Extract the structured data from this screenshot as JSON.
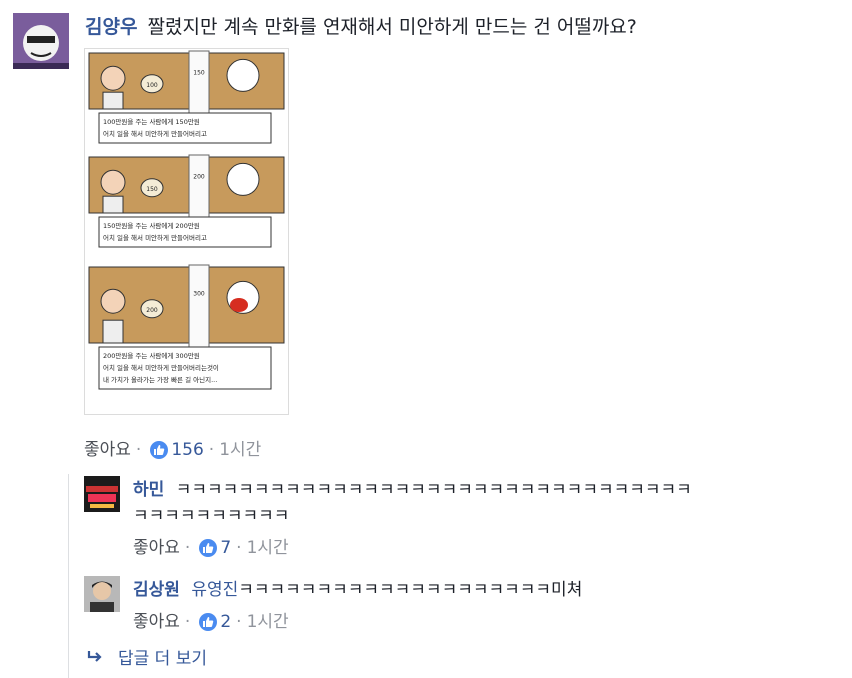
{
  "comment": {
    "author": "김양우",
    "text": "짤렸지만 계속 만화를 연재해서 미안하게 만드는 건 어떨까요?",
    "like_label": "좋아요",
    "like_count": "156",
    "time": "1시간",
    "comic": {
      "panels": [
        {
          "bag": "100",
          "board": "150",
          "caption_lines": [
            "100만원을 주는 사람에게 150만원",
            "어치 일을 해서 미안하게 만들어버리고"
          ]
        },
        {
          "bag": "150",
          "board": "200",
          "caption_lines": [
            "150만원을 주는 사람에게 200만원",
            "어치 일을 해서 미안하게 만들어버리고"
          ]
        },
        {
          "bag": "200",
          "board": "300",
          "caption_lines": [
            "200만원을 주는 사람에게 300만원",
            "어치 일을 해서 미안하게 만들어버리는것이",
            "내 가치가 올라가는 가장 빠른 길 아닌지..."
          ]
        }
      ]
    }
  },
  "replies": [
    {
      "author": "하민",
      "text_line1": "ㅋㅋㅋㅋㅋㅋㅋㅋㅋㅋㅋㅋㅋㅋㅋㅋㅋㅋㅋㅋㅋㅋㅋㅋㅋㅋㅋㅋㅋㅋㅋㅋㅋ",
      "text_line2": "ㅋㅋㅋㅋㅋㅋㅋㅋㅋㅋ",
      "like_label": "좋아요",
      "like_count": "7",
      "time": "1시간"
    },
    {
      "author": "김상원",
      "mention": "유영진",
      "text": "ㅋㅋㅋㅋㅋㅋㅋㅋㅋㅋㅋㅋㅋㅋㅋㅋㅋㅋㅋㅋ미쳐",
      "like_label": "좋아요",
      "like_count": "2",
      "time": "1시간"
    }
  ],
  "more_replies": "답글 더 보기",
  "colors": {
    "name": "#365899",
    "like_badge": "#4a8bf0",
    "comic_bg": "#c79a5c"
  }
}
